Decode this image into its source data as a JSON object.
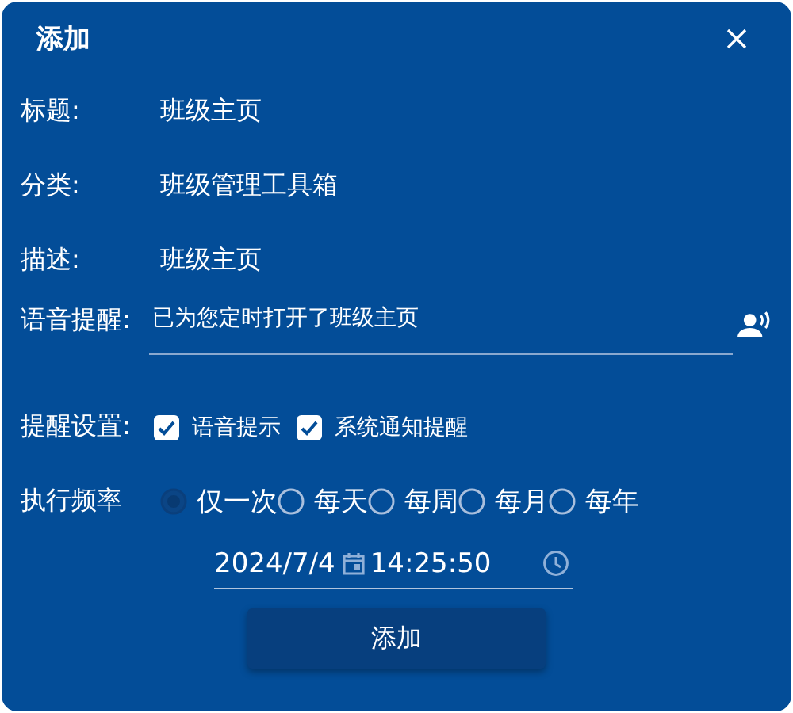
{
  "dialog": {
    "title": "添加"
  },
  "fields": [
    {
      "label": "标题:",
      "value": "班级主页"
    },
    {
      "label": "分类:",
      "value": "班级管理工具箱"
    },
    {
      "label": "描述:",
      "value": "班级主页"
    }
  ],
  "voice": {
    "label": "语音提醒:",
    "value": "已为您定时打开了班级主页"
  },
  "settings": {
    "label": "提醒设置:",
    "options": [
      {
        "label": "语音提示",
        "checked": true
      },
      {
        "label": "系统通知提醒",
        "checked": true
      }
    ]
  },
  "frequency": {
    "label": "执行频率",
    "options": [
      {
        "label": "仅一次",
        "selected": true
      },
      {
        "label": "每天",
        "selected": false
      },
      {
        "label": "每周",
        "selected": false
      },
      {
        "label": "每月",
        "selected": false
      },
      {
        "label": "每年",
        "selected": false
      }
    ]
  },
  "datetime": {
    "date": "2024/7/4",
    "time": "14:25:50"
  },
  "submit": "添加"
}
